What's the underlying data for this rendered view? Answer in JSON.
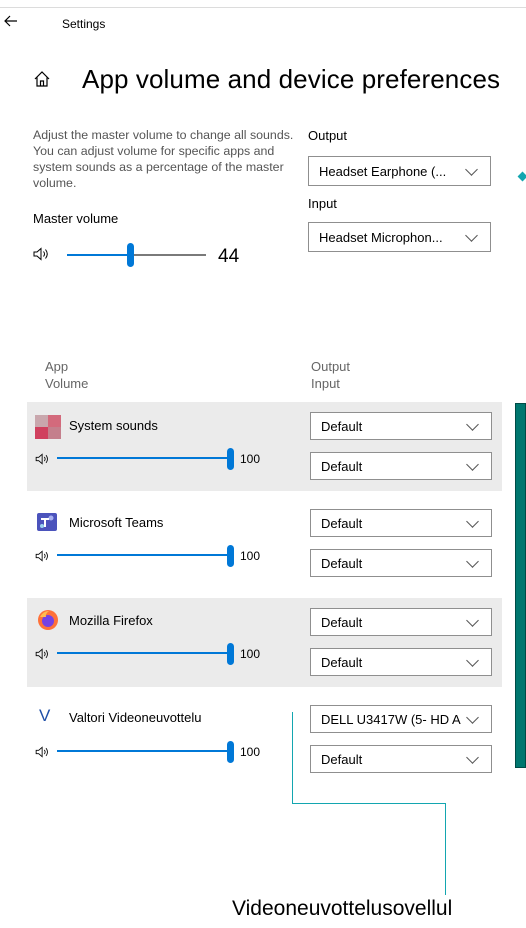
{
  "header": {
    "back_icon": "back-arrow-icon",
    "title": "Settings"
  },
  "page": {
    "title": "App volume and device preferences",
    "description": "Adjust the master volume to change all sounds. You can adjust volume for specific apps and system sounds as a percentage of the master volume."
  },
  "master": {
    "label": "Master volume",
    "value": "44",
    "level_percent": 44
  },
  "devices": {
    "output_label": "Output",
    "output_value": "Headset Earphone (...",
    "input_label": "Input",
    "input_value": "Headset Microphon..."
  },
  "columns": {
    "app": "App",
    "volume": "Volume",
    "output": "Output",
    "input": "Input"
  },
  "apps": [
    {
      "name": "System sounds",
      "icon": "system-sounds-icon",
      "volume": "100",
      "output": "Default",
      "input": "Default"
    },
    {
      "name": "Microsoft Teams",
      "icon": "teams-icon",
      "volume": "100",
      "output": "Default",
      "input": "Default"
    },
    {
      "name": "Mozilla Firefox",
      "icon": "firefox-icon",
      "volume": "100",
      "output": "Default",
      "input": "Default"
    },
    {
      "name": "Valtori Videoneuvottelu",
      "icon": "valtori-icon",
      "icon_letter": "V",
      "volume": "100",
      "output": "DELL U3417W (5- HD A",
      "input": "Default"
    }
  ],
  "annotation": {
    "callout_text": "Videoneuvottelusovellul",
    "color": "#13a6b0"
  },
  "colors": {
    "accent": "#0078d7",
    "teal_panel": "#00776f"
  }
}
